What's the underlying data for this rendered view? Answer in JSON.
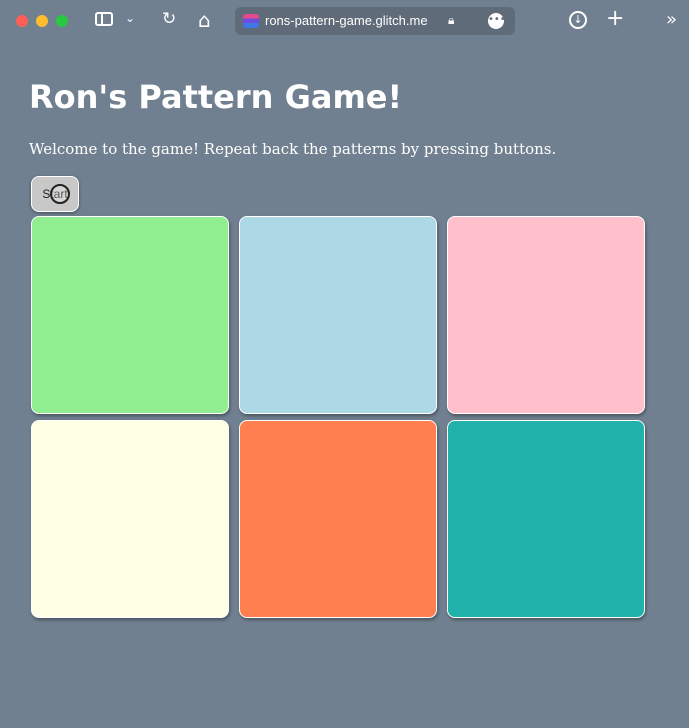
{
  "browser": {
    "url": "rons-pattern-game.glitch.me",
    "icons": [
      "sidebar-icon",
      "chevron-down-icon",
      "reload-icon",
      "home-icon",
      "lock-icon",
      "more-icon",
      "download-icon",
      "plus-icon",
      "chevrons-right-icon"
    ]
  },
  "page": {
    "title": "Ron's Pattern Game!",
    "intro": "Welcome to the game! Repeat back the patterns by pressing buttons.",
    "start_label": "Start"
  },
  "colors": {
    "background": "#708090",
    "pads": [
      "#90ee90",
      "#add8e6",
      "#ffc0cb",
      "#ffffe6",
      "#ff7f50",
      "#20b2aa"
    ]
  }
}
